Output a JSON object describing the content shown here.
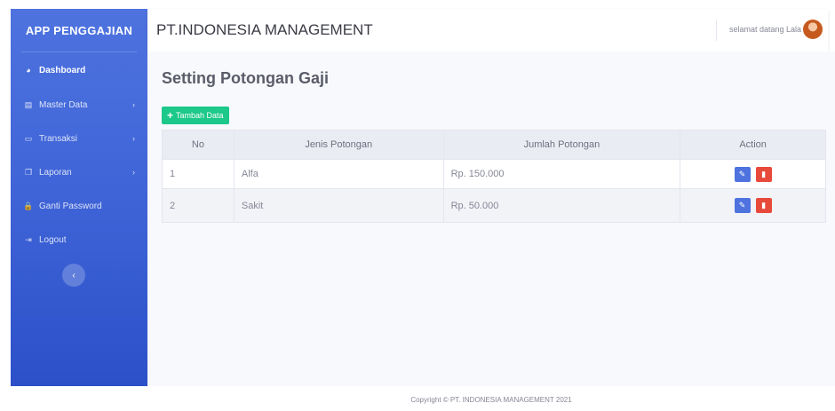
{
  "sidebar": {
    "brand": "APP PENGGAJIAN",
    "items": [
      {
        "label": "Dashboard",
        "icon": "dashboard-icon",
        "glyph": "◕",
        "chevron": ""
      },
      {
        "label": "Master Data",
        "icon": "database-icon",
        "glyph": "▤",
        "chevron": "›"
      },
      {
        "label": "Transaksi",
        "icon": "money-icon",
        "glyph": "▭",
        "chevron": "›"
      },
      {
        "label": "Laporan",
        "icon": "copy-icon",
        "glyph": "❐",
        "chevron": "›"
      },
      {
        "label": "Ganti Password",
        "icon": "lock-icon",
        "glyph": "🔒",
        "chevron": ""
      },
      {
        "label": "Logout",
        "icon": "logout-icon",
        "glyph": "⇥",
        "chevron": ""
      }
    ],
    "toggle_glyph": "‹"
  },
  "topbar": {
    "company": "PT.INDONESIA MANAGEMENT",
    "welcome": "selamat datang Lala"
  },
  "main": {
    "title": "Setting Potongan Gaji",
    "add_label": "Tambah Data",
    "table": {
      "headers": [
        "No",
        "Jenis Potongan",
        "Jumlah Potongan",
        "Action"
      ],
      "rows": [
        {
          "no": "1",
          "jenis": "Alfa",
          "jumlah": "Rp. 150.000"
        },
        {
          "no": "2",
          "jenis": "Sakit",
          "jumlah": "Rp. 50.000"
        }
      ]
    }
  },
  "footer": "Copyright © PT. INDONESIA MANAGEMENT 2021",
  "colors": {
    "primary": "#4e73df",
    "success": "#1cc88a",
    "danger": "#e74a3b"
  }
}
